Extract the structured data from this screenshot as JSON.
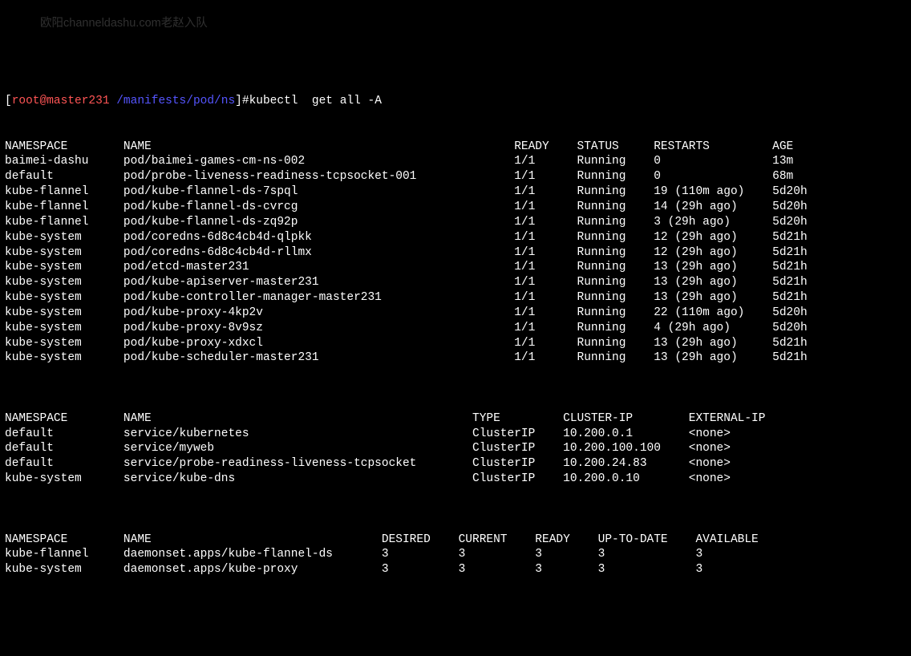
{
  "prompt": {
    "bracket_open": "[",
    "user_host": "root@master231",
    "path": " /manifests/pod/ns",
    "bracket_close": "]#",
    "command": "kubectl  get all -A"
  },
  "watermark_text": "欧阳channeldashu.com老赵入队",
  "pods": {
    "header": {
      "namespace": "NAMESPACE",
      "name": "NAME",
      "ready": "READY",
      "status": "STATUS",
      "restarts": "RESTARTS",
      "age": "AGE"
    },
    "rows": [
      {
        "namespace": "baimei-dashu",
        "name": "pod/baimei-games-cm-ns-002",
        "ready": "1/1",
        "status": "Running",
        "restarts": "0",
        "age": "13m"
      },
      {
        "namespace": "default",
        "name": "pod/probe-liveness-readiness-tcpsocket-001",
        "ready": "1/1",
        "status": "Running",
        "restarts": "0",
        "age": "68m"
      },
      {
        "namespace": "kube-flannel",
        "name": "pod/kube-flannel-ds-7spql",
        "ready": "1/1",
        "status": "Running",
        "restarts": "19 (110m ago)",
        "age": "5d20h"
      },
      {
        "namespace": "kube-flannel",
        "name": "pod/kube-flannel-ds-cvrcg",
        "ready": "1/1",
        "status": "Running",
        "restarts": "14 (29h ago)",
        "age": "5d20h"
      },
      {
        "namespace": "kube-flannel",
        "name": "pod/kube-flannel-ds-zq92p",
        "ready": "1/1",
        "status": "Running",
        "restarts": "3 (29h ago)",
        "age": "5d20h"
      },
      {
        "namespace": "kube-system",
        "name": "pod/coredns-6d8c4cb4d-qlpkk",
        "ready": "1/1",
        "status": "Running",
        "restarts": "12 (29h ago)",
        "age": "5d21h"
      },
      {
        "namespace": "kube-system",
        "name": "pod/coredns-6d8c4cb4d-rllmx",
        "ready": "1/1",
        "status": "Running",
        "restarts": "12 (29h ago)",
        "age": "5d21h"
      },
      {
        "namespace": "kube-system",
        "name": "pod/etcd-master231",
        "ready": "1/1",
        "status": "Running",
        "restarts": "13 (29h ago)",
        "age": "5d21h"
      },
      {
        "namespace": "kube-system",
        "name": "pod/kube-apiserver-master231",
        "ready": "1/1",
        "status": "Running",
        "restarts": "13 (29h ago)",
        "age": "5d21h"
      },
      {
        "namespace": "kube-system",
        "name": "pod/kube-controller-manager-master231",
        "ready": "1/1",
        "status": "Running",
        "restarts": "13 (29h ago)",
        "age": "5d21h"
      },
      {
        "namespace": "kube-system",
        "name": "pod/kube-proxy-4kp2v",
        "ready": "1/1",
        "status": "Running",
        "restarts": "22 (110m ago)",
        "age": "5d20h"
      },
      {
        "namespace": "kube-system",
        "name": "pod/kube-proxy-8v9sz",
        "ready": "1/1",
        "status": "Running",
        "restarts": "4 (29h ago)",
        "age": "5d20h"
      },
      {
        "namespace": "kube-system",
        "name": "pod/kube-proxy-xdxcl",
        "ready": "1/1",
        "status": "Running",
        "restarts": "13 (29h ago)",
        "age": "5d21h"
      },
      {
        "namespace": "kube-system",
        "name": "pod/kube-scheduler-master231",
        "ready": "1/1",
        "status": "Running",
        "restarts": "13 (29h ago)",
        "age": "5d21h"
      }
    ]
  },
  "services": {
    "header": {
      "namespace": "NAMESPACE",
      "name": "NAME",
      "type": "TYPE",
      "cluster_ip": "CLUSTER-IP",
      "external_ip": "EXTERNAL-IP"
    },
    "rows": [
      {
        "namespace": "default",
        "name": "service/kubernetes",
        "type": "ClusterIP",
        "cluster_ip": "10.200.0.1",
        "external_ip": "<none>"
      },
      {
        "namespace": "default",
        "name": "service/myweb",
        "type": "ClusterIP",
        "cluster_ip": "10.200.100.100",
        "external_ip": "<none>"
      },
      {
        "namespace": "default",
        "name": "service/probe-readiness-liveness-tcpsocket",
        "type": "ClusterIP",
        "cluster_ip": "10.200.24.83",
        "external_ip": "<none>"
      },
      {
        "namespace": "kube-system",
        "name": "service/kube-dns",
        "type": "ClusterIP",
        "cluster_ip": "10.200.0.10",
        "external_ip": "<none>"
      }
    ]
  },
  "daemonsets": {
    "header": {
      "namespace": "NAMESPACE",
      "name": "NAME",
      "desired": "DESIRED",
      "current": "CURRENT",
      "ready": "READY",
      "up_to_date": "UP-TO-DATE",
      "available": "AVAILABLE"
    },
    "rows": [
      {
        "namespace": "kube-flannel",
        "name": "daemonset.apps/kube-flannel-ds",
        "desired": "3",
        "current": "3",
        "ready": "3",
        "up_to_date": "3",
        "available": "3"
      },
      {
        "namespace": "kube-system",
        "name": "daemonset.apps/kube-proxy",
        "desired": "3",
        "current": "3",
        "ready": "3",
        "up_to_date": "3",
        "available": "3"
      }
    ]
  }
}
